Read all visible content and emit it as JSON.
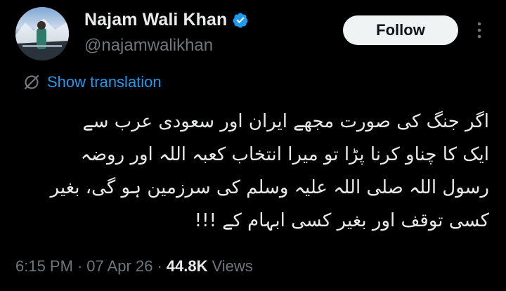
{
  "author": {
    "display_name": "Najam Wali Khan",
    "handle": "@najamwalikhan",
    "verified_color": "#1d9bf0"
  },
  "follow_label": "Follow",
  "translation": {
    "label": "Show translation",
    "icon": "globe-icon"
  },
  "tweet": {
    "lines": [
      "اگر جنگ کی صورت مجھے ایران اور سعودی عرب سے",
      "ایک کا چناو کرنا پڑا تو میرا انتخاب کعبہ اللہ اور روضہ",
      "رسول اللہ صلی اللہ علیہ وسلم کی سرزمین ہو گی، بغیر",
      "کسی توقف اور بغیر کسی ابہام کے !!!"
    ]
  },
  "meta": {
    "time": "6:15 PM",
    "separator": "·",
    "date": "07 Apr 26",
    "views_count": "44.8K",
    "views_label": "Views"
  },
  "colors": {
    "background": "#000000",
    "text": "#e7e9ea",
    "secondary": "#71767b",
    "accent": "#1d9bf0",
    "button_bg": "#eff3f4"
  }
}
